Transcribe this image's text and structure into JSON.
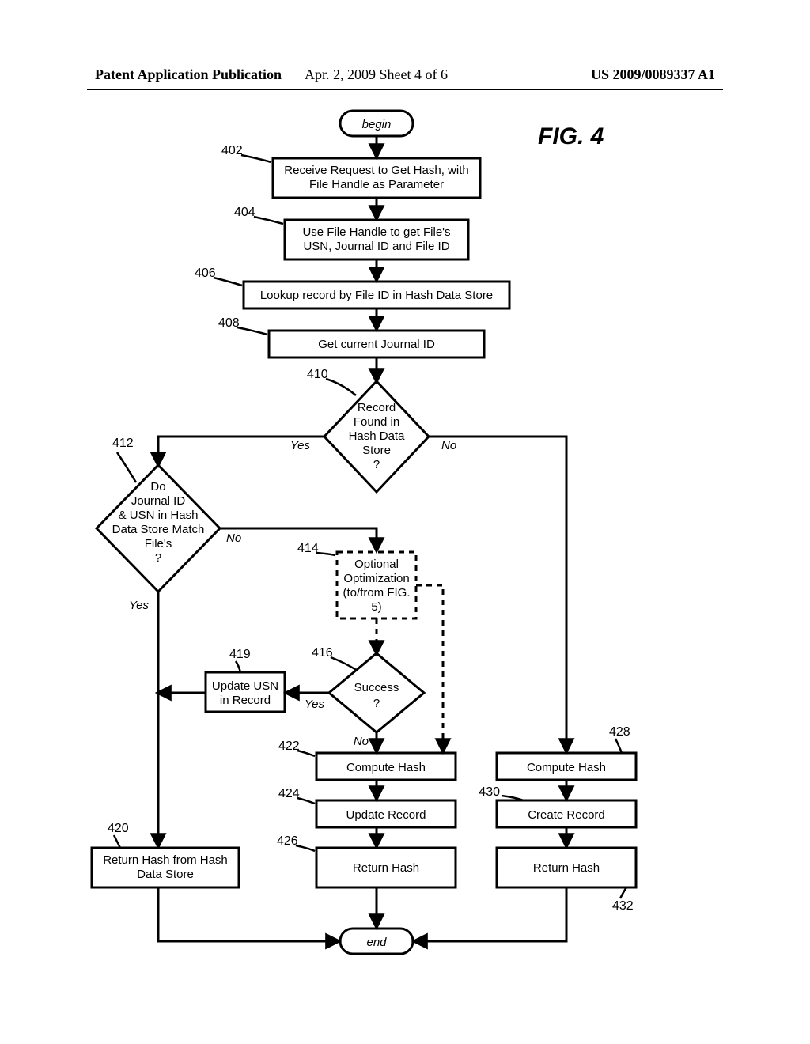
{
  "header": {
    "left": "Patent Application Publication",
    "center": "Apr. 2, 2009  Sheet 4 of 6",
    "right": "US 2009/0089337 A1"
  },
  "figure_title": "FIG. 4",
  "terminals": {
    "begin": "begin",
    "end": "end"
  },
  "refs": {
    "r402": "402",
    "r404": "404",
    "r406": "406",
    "r408": "408",
    "r410": "410",
    "r412": "412",
    "r414": "414",
    "r416": "416",
    "r419": "419",
    "r420": "420",
    "r422": "422",
    "r424": "424",
    "r426": "426",
    "r428": "428",
    "r430": "430",
    "r432": "432"
  },
  "boxes": {
    "b402_l1": "Receive Request to Get Hash, with",
    "b402_l2": "File Handle as Parameter",
    "b404_l1": "Use File Handle to get File's",
    "b404_l2": "USN, Journal ID and File ID",
    "b406": "Lookup record by File ID in Hash Data Store",
    "b408": "Get current Journal ID",
    "b419_l1": "Update USN",
    "b419_l2": "in Record",
    "b422": "Compute Hash",
    "b424": "Update Record",
    "b426": "Return Hash",
    "b428": "Compute Hash",
    "b430": "Create Record",
    "b432": "Return Hash",
    "b420_l1": "Return Hash from Hash",
    "b420_l2": "Data Store",
    "b414_l1": "Optional",
    "b414_l2": "Optimization",
    "b414_l3": "(to/from FIG.",
    "b414_l4": "5)"
  },
  "decisions": {
    "d410_l1": "Record",
    "d410_l2": "Found in",
    "d410_l3": "Hash Data",
    "d410_l4": "Store",
    "d410_l5": "?",
    "d412_l1": "Do",
    "d412_l2": "Journal ID",
    "d412_l3": "& USN in Hash",
    "d412_l4": "Data Store Match",
    "d412_l5": "File's",
    "d412_l6": "?",
    "d416_l1": "Success",
    "d416_l2": "?"
  },
  "labels": {
    "yes": "Yes",
    "no": "No"
  }
}
